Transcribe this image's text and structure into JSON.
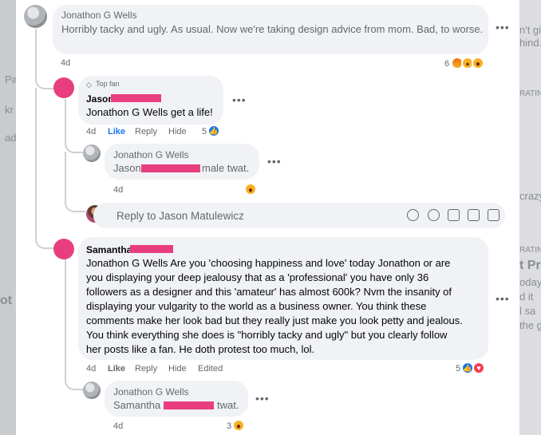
{
  "background": {
    "left_fragments": [
      "Pa",
      "kr",
      "ad",
      "ot"
    ],
    "right_fragments": [
      "n't gi",
      "hind.",
      "RATIN",
      "crazy",
      "RATIN",
      "t Pr",
      "oday",
      "d it",
      "l sa",
      "the g"
    ]
  },
  "comments": [
    {
      "author": "Jonathon G Wells",
      "text": "Horribly tacky and ugly. As usual. Now we're taking design advice from mom. Bad, to worse.",
      "time": "4d",
      "reaction_count": "6",
      "reactions": [
        "angry",
        "wow",
        "haha"
      ]
    },
    {
      "badge": "Top fan",
      "author": "Jason",
      "text": "Jonathon G Wells get a life!",
      "time": "4d",
      "actions": [
        "Like",
        "Reply",
        "Hide"
      ],
      "reaction_count": "5",
      "reactions": [
        "like"
      ],
      "replies": [
        {
          "author": "Jonathon G Wells",
          "text_prefix": "Jason",
          "text_suffix": "male twat.",
          "time": "4d",
          "reactions": [
            "haha"
          ]
        }
      ]
    },
    {
      "author": "Samantha",
      "text_lines": [
        "Jonathon G Wells Are you 'choosing happiness and love' today Jonathon or are",
        "you displaying your deep jealousy that as a 'professional' you have only 36",
        "followers as a designer and this 'amateur' has almost 600k? Nvm the insanity of",
        "displaying your vulgarity to the world as a business owner. You think these",
        "comments make her look bad but they really just make you look petty and jealous.",
        "You think everything she does is \"horribly tacky and ugly\" but you clearly follow",
        "her posts like a fan. He doth protest too much, lol."
      ],
      "time": "4d",
      "actions": [
        "Like",
        "Reply",
        "Hide",
        "Edited"
      ],
      "reaction_count": "5",
      "reactions": [
        "like",
        "love"
      ],
      "replies": [
        {
          "author": "Jonathon G Wells",
          "text_prefix": "Samantha",
          "text_suffix": "twat.",
          "time": "4d",
          "reaction_count": "3",
          "reactions": [
            "haha"
          ]
        }
      ]
    }
  ],
  "reply_composer": {
    "placeholder": "Reply to Jason Matulewicz",
    "tools": [
      "avatar-sticker-icon",
      "emoji-icon",
      "camera-icon",
      "gif-icon",
      "sticker-icon"
    ]
  },
  "colors": {
    "redaction": "#e83e7f",
    "link_blue": "#1877f2",
    "bubble": "#f0f2f5"
  }
}
